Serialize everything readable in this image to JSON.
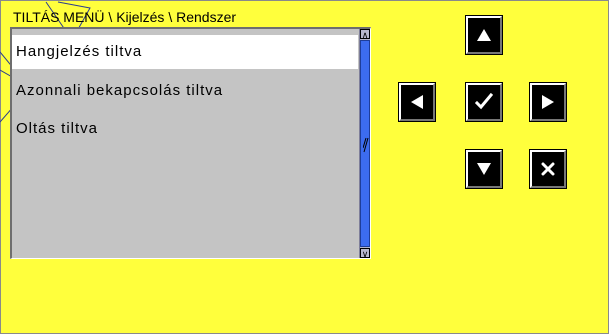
{
  "breadcrumb": "TILTÁS MENÜ \\ Kijelzés \\ Rendszer",
  "menu": {
    "items": [
      {
        "label": "Hangjelzés tiltva",
        "selected": true
      },
      {
        "label": "Azonnali bekapcsolás tiltva",
        "selected": false
      },
      {
        "label": "Oltás tiltva",
        "selected": false
      }
    ]
  },
  "scrollbar": {
    "up_glyph": "∧",
    "down_glyph": "∨"
  },
  "buttons": {
    "up": "arrow-up-icon",
    "left": "arrow-left-icon",
    "ok": "checkmark-icon",
    "right": "arrow-right-icon",
    "down": "arrow-down-icon",
    "cancel": "cancel-x-icon"
  },
  "colors": {
    "background": "#ffff3c",
    "list_background": "#c4c4c4",
    "selected_row": "#ffffff",
    "scroll_thumb": "#3c6cf0",
    "button": "#000000"
  }
}
